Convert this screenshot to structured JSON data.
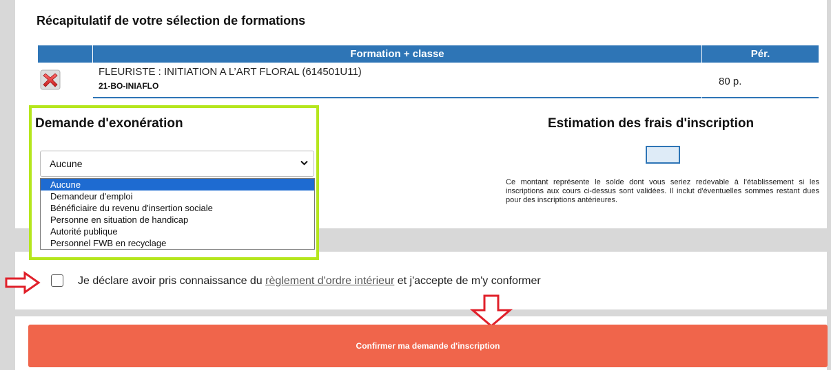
{
  "summary": {
    "title": "Récapitulatif de votre sélection de formations",
    "columns": [
      "",
      "Formation + classe",
      "Pér."
    ],
    "rows": [
      {
        "name": "FLEURISTE : INITIATION A L’ART FLORAL (614501U11)",
        "code": "21-BO-INIAFLO",
        "period": "80 p.",
        "remove_icon": "remove-x-icon"
      }
    ]
  },
  "exemption": {
    "title": "Demande d'exonération",
    "selected": "Aucune",
    "options": [
      "Aucune",
      "Demandeur d'emploi",
      "Bénéficiaire du revenu d'insertion sociale",
      "Personne en situation de handicap",
      "Autorité publique",
      "Personnel FWB en recyclage"
    ],
    "highlight_color": "#b5e61d"
  },
  "estimation": {
    "title": "Estimation des frais d'inscription",
    "amount": "",
    "note": "Ce montant représente le solde dont vous seriez redevable à l'établissement si les inscriptions aux cours ci-dessus sont validées. Il inclut d'éventuelles sommes restant dues pour des inscriptions antérieures."
  },
  "agreement": {
    "text_before": "Je déclare avoir pris connaissance du ",
    "link": "règlement d'ordre intérieur",
    "text_after": " et j'accepte de m'y conformer",
    "checked": false
  },
  "confirm": {
    "label": "Confirmer ma demande d'inscription",
    "color": "#f0654b"
  },
  "annotations": {
    "arrow_color": "#e0202a"
  },
  "colors": {
    "header": "#2e75b6",
    "background": "#d8d8d8"
  }
}
